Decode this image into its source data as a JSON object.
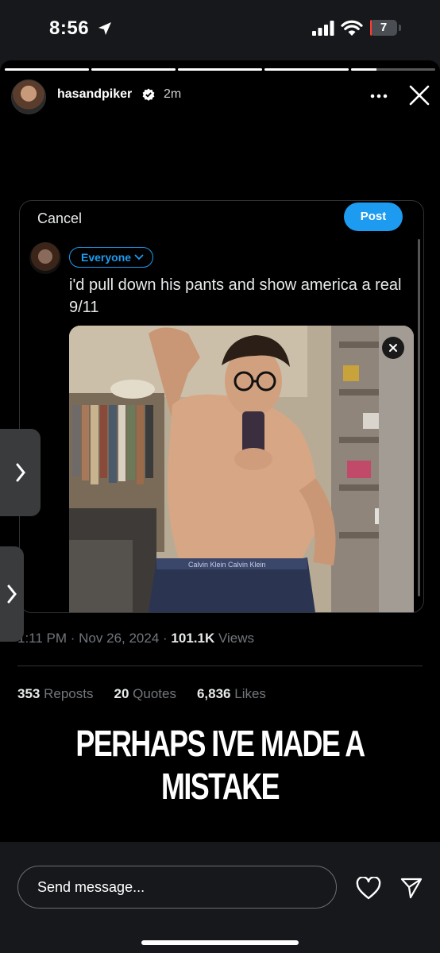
{
  "status_bar": {
    "time": "8:56",
    "battery": "7",
    "battery_level": 0.07
  },
  "story": {
    "progress_segments": [
      1,
      1,
      1,
      1,
      0.3
    ],
    "username": "hasandpiker",
    "time_ago": "2m"
  },
  "compose": {
    "cancel_label": "Cancel",
    "post_label": "Post",
    "audience_label": "Everyone",
    "tweet_text": "i'd pull down his pants and show america a real 9/11",
    "meta_time": "1:11 PM · Nov 26, 2024 · ",
    "meta_views_count": "101.1K",
    "meta_views_label": " Views",
    "stats": [
      {
        "count": "353",
        "label": "Reposts"
      },
      {
        "count": "20",
        "label": "Quotes"
      },
      {
        "count": "6,836",
        "label": "Likes"
      }
    ]
  },
  "caption": "PERHAPS IVE MADE A MISTAKE",
  "bottom": {
    "message_placeholder": "Send message..."
  },
  "colors": {
    "accent": "#1d9bf0",
    "background": "#000000",
    "muted": "#71767b"
  },
  "icons": [
    "location-arrow-icon",
    "signal-icon",
    "wifi-icon",
    "battery-icon",
    "verified-icon",
    "more-icon",
    "close-icon",
    "chevron-down-icon",
    "remove-image-icon",
    "chevron-right-icon",
    "heart-icon",
    "send-icon"
  ]
}
